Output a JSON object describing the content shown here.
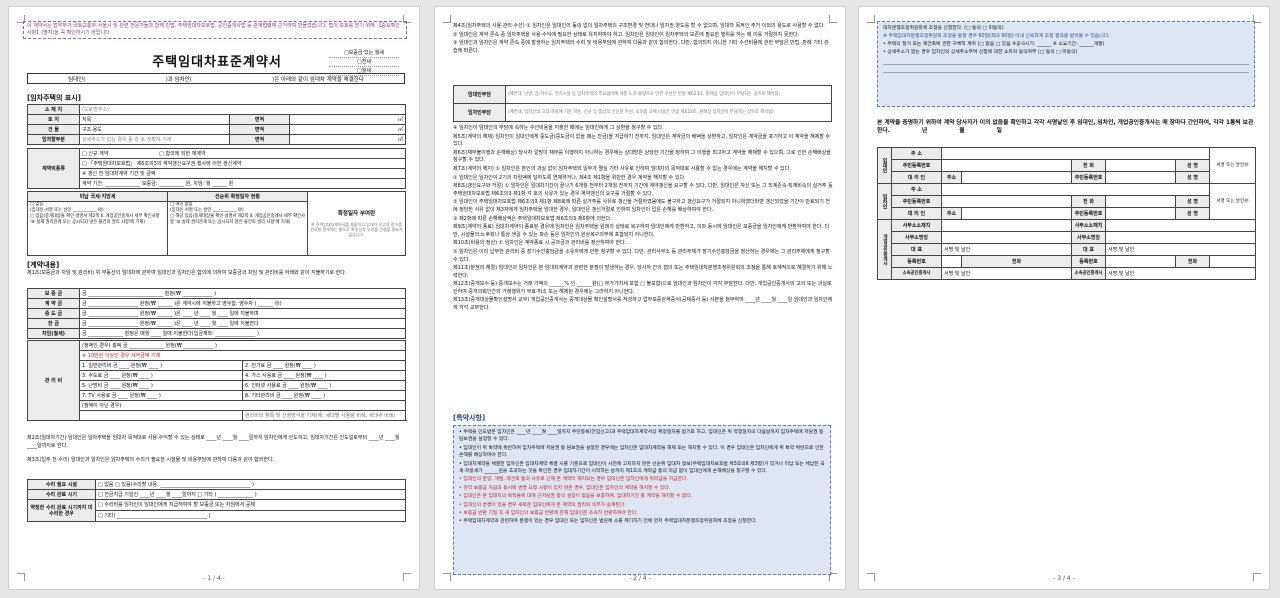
{
  "page1": {
    "notice": "이 계약서는 법무부가 국토교통부·서울시 및 관련 전문가들과 함께 민법, 주택임대차보호법, 공인중개사법 등 관계법령에 근거하여 만들었습니다. 법의 보호를 받기 위해 【중요확인사항】(별지)을 꼭 확인하시기 바랍니다.",
    "title": "주택임대차표준계약서",
    "stamp_lines": [
      "□보증금 있는 월세",
      "□전세",
      "□월세"
    ],
    "party_line": [
      "임대인(",
      ")과 임차인(",
      ")은 아래와 같이 임대차 계약을 체결한다"
    ],
    "section1": "[임차주택의 표시]",
    "property_rows": [
      [
        "소 재 지",
        "(도로명주소)",
        "",
        ""
      ],
      [
        "토    지",
        "지목",
        "면적",
        "㎡"
      ],
      [
        "건    물",
        "구조·용도",
        "면적",
        "㎡"
      ],
      [
        "임차할부분",
        "상세주소가 있는 경우 동·층·호 정확히 기재",
        "면적",
        "㎡"
      ]
    ],
    "contract_type_label": "계약의종류",
    "contract_type_items": [
      "□ 신규 계약",
      "□ 합의에 의한 재계약",
      "□ 「주택임대차보호법」 제6조의3의 계약갱신요구권 행사에 의한 갱신계약",
      "※ 갱신 전 임대차계약 기간 및 금액",
      "계약 기간:",
      "보증금:",
      "원, 차임: 월",
      "원"
    ],
    "tax_headers": [
      "미납 국세·지방세",
      "선순위 확정일자 현황",
      "확정일자 부여란"
    ],
    "tax_items": [
      "□ 없음",
      "(임대인 서명 또는 날인 ___________ ㊞)",
      "□ 있음(중개대상물 확인·설명서 제2쪽 Ⅱ. 개업공인중개사 세부 확인사항 '⑨ 실제 권리관계 또는 공시되지 않은 물건의 권리 사항'에 기재)",
      "□ 해당 없음",
      "(임대인 서명 또는 날인 ___________ ㊞)",
      "□ 해당 있음(중개대상물 확인·설명서 제2쪽 Ⅱ. 개업공인중개사 세부 확인사항 '⑨ 실제 권리관계 또는 공시되지 않은 물건의 권리 사항'에 기재)",
      "※ 주택임대차계약서를 제출하고 임대차 신고의 접수를 완료한 경우에는 별도로 확정일자 부여를 신청할 필요가 없습니다."
    ],
    "section2": "[계약내용]",
    "clause1": "제1조(보증금과 차임 및 관리비) 위 부동산의 임대차에 관하여 임대인과 임차인은 합의에 의하여 보증금과 차임 및 관리비를 아래와 같이 지불하기로 한다.",
    "money_rows": [
      [
        "보 증 금",
        "금",
        "원정(₩",
        ")"
      ],
      [
        "계 약 금",
        "금",
        "원정(₩",
        ")은 계약시에 지불하고 영수함. 영수자 (",
        "㊞)"
      ],
      [
        "중 도 금",
        "금",
        "원정(₩",
        ")은",
        "년",
        "월",
        "일에 지불하며"
      ],
      [
        "잔    금",
        "금",
        "원정(₩",
        ")은",
        "년",
        "월",
        "일에 지불한다"
      ],
      [
        "차임(월세)",
        "금",
        "원정은 매월",
        "일에 지불한다(입금계좌:",
        ")"
      ]
    ],
    "mgmt_label": "관 리 비",
    "mgmt_fixed": "(정액인 경우) 총액 금",
    "mgmt_fixed_2": "원정(₩",
    "mgmt_note": "※ 10만원 이상인 경우 세부금액 기재",
    "mgmt_items": [
      [
        "1. 일반관리비",
        "금",
        "원정(₩",
        ")"
      ],
      [
        "2. 전기료",
        "금",
        "원정(₩",
        ")"
      ],
      [
        "3. 수도료",
        "금",
        "원정(₩",
        ")"
      ],
      [
        "4. 가스 사용료",
        "금",
        "원정(₩",
        ")"
      ],
      [
        "5. 난방비",
        "금",
        "원정(₩",
        ")"
      ],
      [
        "6. 인터넷 사용료",
        "금",
        "원정(₩",
        ")"
      ],
      [
        "7. TV 사용료",
        "금",
        "원정(₩",
        ")"
      ],
      [
        "8. 기타관리비",
        "금",
        "원정(₩",
        ")"
      ]
    ],
    "mgmt_variable": "(정액이 아닌 경우)",
    "mgmt_variable_note": "관리비의 항목 및 산정방식을 기재(예: 세대별 사용량 비례, 세대수 비례)",
    "clause2": "제2조(임대차기간) 임대인은 임차주택을 임대차 목적대로 사용·수익할 수 있는 상태로 ____년 ____월 ____일까지 임차인에게 인도하고, 임대차기간은 인도일로부터 ____년 ____월 ____일까지로 한다.",
    "clause3": "제3조(입주 전 수리) 임대인과 임차인은 임차주택의 수리가 필요한 시설물 및 비용부담에 관하여 다음과 같이 합의한다.",
    "repair_rows": [
      [
        "수리 필요 시설",
        "□ 없음 □ 있음(수리할 내용:",
        ")"
      ],
      [
        "수리 완료 시기",
        "□ 잔금지급 기일인 ____년 ____월 ____일까지 □ 기타 (",
        ")"
      ],
      [
        "약정한 수리 완료 시기까지 미 수리한 경우",
        "□ 수리비를 임차인이 임대인에게 지급하여야 할 보증금 또는 차임에서 공제",
        "□ 기타(",
        ")"
      ]
    ],
    "page_num": "- 1 / 4 -"
  },
  "page2": {
    "paragraphs": [
      "제4조(임차주택의 사용·관리·수선) ① 임차인은 임대인의 동의 없이 임차주택의 구조변경 및 전대나 임차권 양도를 할 수 없으며, 임대차 목적인 주거 이외의 용도로 사용할 수 없다.",
      "② 임대인은 계약 존속 중 임차주택을 사용·수익에 필요한 상태로 유지하여야 하고, 임차인은 임대인이 임차주택의 보존에 필요한 행위를 하는 때 이를 거절하지 못한다.",
      "③ 임대인과 임차인은 계약 존속 중에 발생하는 임차주택의 수리 및 비용부담에 관하여 다음과 같이 합의한다. 다만, 합의되지 아니한 기타 수선비용에 관한 부담은 민법, 판례 기타 관습에 따른다."
    ],
    "cost_rows": [
      [
        "임대인부담",
        "(예컨대, 난방, 상·하수도, 전기시설 등 임차주택의 주요설비에 대한 노후·불량으로 인한 수선은 민법 제623조, 판례상 임대인이 부담하는 것으로 해석됨)"
      ],
      [
        "임차인부담",
        "(예컨대, 임차인의 고의·과실에 기한 파손, 전구 등 통상의 간단한 수선, 소모품 교체 비용은 민법 제623조, 판례상 임차인이 부담하는 것으로 해석됨)"
      ]
    ],
    "paragraphs_b": [
      "④ 임차인이 임대인의 부담에 속하는 수선비용을 지출한 때에는 임대인에게 그 상환을 청구할 수 있다.",
      "제5조(계약의 해제) 임차인이 임대인에게 중도금(중도금이 없을 때는 잔금)을 지급하기 전까지, 임대인은 계약금의 배액을 상환하고, 임차인은 계약금을 포기하고 이 계약을 해제할 수 있다.",
      "제6조(채무불이행과 손해배상) 당사자 일방이 채무를 이행하지 아니하는 경우에는 상대방은 상당한 기간을 정하여 그 이행을 최고하고 계약을 해제할 수 있으며, 그로 인한 손해배상을 청구할 수 있다.",
      "제7조(계약의 해지) ① 임차인은 본인의 과실 없이 임차주택의 일부가 멸실 기타 사유로 인하여 임대차의 목적대로 사용할 수 없는 경우에는 계약을 해지할 수 있다.",
      "② 임대인은 임차인이 2기의 차임액에 달하도록 연체하거나, 제4조 제1항을 위반한 경우 계약을 해지할 수 있다.",
      "제8조(갱신요구와 거절) ① 임차인은 임대차기간이 끝나기 6개월 전부터 2개월 전까지 기간에 계약갱신을 요구할 수 있다. 다만, 임대인은 자신 또는 그 직계존속·직계비속의 실거주 등 주택임대차보호법 제6조의3 제1항 각 호의 사유가 있는 경우 계약갱신의 요구를 거절할 수 있다.",
      "② 임대인이 주택임대차보호법 제6조의3 제1항 제8호에 따른 실거주를 사유로 갱신을 거절하였음에도 불구하고 갱신요구가 거절되지 아니하였더라면 갱신되었을 기간이 만료되기 전에 정당한 사유 없이 제3자에게 임차주택을 임대한 경우, 임대인은 갱신거절로 인하여 임차인이 입은 손해를 배상하여야 한다.",
      "③ 제2항에 따른 손해배상액은 주택임대차보호법 제6조의3 제6항에 의한다.",
      "제9조(계약의 종료) 임대차계약이 종료된 경우에 임차인은 임차주택을 원래의 상태로 복구하여 임대인에게 반환하고, 이와 동시에 임대인은 보증금을 임차인에게 반환하여야 한다. 다만, 시설물의 노후화나 통상 생길 수 있는 파손 등은 임차인의 원상복구의무에 포함되지 아니한다.",
      "제10조(비용의 정산) ① 임차인은 계약종료 시 공과금과 관리비를 정산하여야 한다.",
      "② 임차인은 이미 납부한 관리비 중 장기수선충당금을 소유자에게 반환 청구할 수 있다. 다만, 관리사무소 등 관리주체가 장기수선충당금을 정산하는 경우에는 그 관리주체에게 청구할 수 있다.",
      "제11조(분쟁의 해결) 임대인과 임차인은 본 임대차계약과 관련한 분쟁이 발생하는 경우, 당사자 간의 협의 또는 주택임대차분쟁조정위원회의 조정을 통해 호혜적으로 해결하기 위해 노력한다.",
      "제12조(중개보수 등) 중개보수는 거래 가액의 ______% 인 ______원(□ 부가가치세 포함 □ 불포함)으로 임대인과 임차인이 각각 부담한다. 다만, 개업공인중개사의 고의 또는 과실로 인하여 중개의뢰인간의 거래행위가 무효·취소 또는 해제된 경우에는 그러하지 아니한다.",
      "제13조(중개대상물확인설명서 교부) 개업공인중개사는 중개대상물 확인설명서를 작성하고 업무보증관계증서(공제증서 등) 사본을 첨부하여 ____년 ____월 ____일 임대인과 임차인에게 각각 교부한다."
    ],
    "special_title": "[특약사항]",
    "special_items": [
      "• 주택을 인도받은 임차인은 ____년 ____월 ____일까지 주민등록(전입신고)과 주택임대차계약서상 확정일자를 받기로 하고, 임대인은 위 약정일자의 다음날까지 임차주택에 저당권 등 담보권을 설정할 수 있다.",
      "• 임대인이 위 특약에 위반하여 임차주택에 저당권 등 담보권을 설정한 경우에는 임차인은 임대차계약을 해제 또는 해지할 수 있다. 이 경우 임대인은 임차인에게 위 특약 위반으로 인한 손해를 배상하여야 한다.",
      "• 임대차계약을 체결한 임차인은 임대차계약 체결 시를 기준으로 임대인이 사전에 고지하지 않은 선순위 임대차 정보(주택임대차보호법 제3조의6 제3항)가 있거나 미납 또는 체납한 국세·지방세가 ______원을 초과하는 것을 확인한 경우 임대차기간이 시작하는 날까지 제1조의 계약금 등의 지급 없이 임대인에게 손해배상을 청구할 수 있다.",
      "• 임대인의 분양, 개발, 재건축 등의 사유로 인해 본 계약이 해지되는 경우 임대인은 임차인에게 위약금을 지급한다.",
      "• 관리 보증금 지급과 동시에 변경 요청 사항이 있지 않은 경우, 임대인은 임차인의 계약을 해지할 수 있다.",
      "• 임대인은 본 임대차의 목적물에 대해 근저당권 등의 설정이 없음을 보증하며, 임대차기간 중 계약을 해지할 수 없다.",
      "• 임대인의 변경이 있을 경우 새로운 임대인에게 본 계약의 권리와 의무가 승계된다.",
      "• 보증금 반환 기일 후 새 임차인의 보증금 반환에 관해 임대인은 조속히 반환하여야 한다.",
      "• 주택임대차계약과 관련하여 분쟁이 있는 경우 임대인 또는 임차인은 법원에 소를 제기하기 전에 먼저 주택임대차분쟁조정위원회에 조정을 신청한다."
    ],
    "page_num": "- 2 / 4 -"
  },
  "page3": {
    "box_lines": [
      "대차분쟁조정위원회에 조정을 신청한다. (□ 동의 □ 미동의)",
      "※ 주택임대차분쟁조정위원회 조정을 통할 경우 60일(최대 90일) 이내 신속하게 조정 결과를 받아볼 수 있습니다.",
      "• 주택의 철거 또는 재건축에 관한 구체적 계획 (□ 없음 □ 있음 ※공사시기: ______ ※ 소요기간: ______개월)",
      "• 상세주소가 없는 경우 임차인의 상세주소부여 신청에 대한 소유자 동의여부 (□ 동의 □ 미동의)"
    ],
    "closing_text": "본 계약을 증명하기 위하여 계약 당사자가 이의 없음을 확인하고 각각 서명날인 후 임대인, 임차인, 개업공인중개사는 매 장마다 간인하여, 각각 1통씩 보관한다.",
    "date_labels": [
      "년",
      "월",
      "일"
    ],
    "landlord_label": "임대인",
    "tenant_label": "임차인",
    "agent_label": "개업공인중개사",
    "sig_fields": [
      "주    소",
      "주민등록번호",
      "전    화",
      "성    명",
      "대 리 인",
      "주소",
      "서명 또는 날인㊞"
    ],
    "agent_fields": [
      "사무소소재지",
      "사무소소재지",
      "사무소명칭",
      "사무소명칭",
      "대    표",
      "서명 및 날인",
      "대    표",
      "서명 및 날인",
      "등록번호",
      "전화",
      "등록번호",
      "전화",
      "소속공인중개사",
      "서명 및 날인",
      "소속공인중개사",
      "서명 및 날인"
    ],
    "page_num": "- 3 / 4 -"
  },
  "colors": {
    "special_bg": "#dde6f2",
    "notice_text": "#8a3a8a",
    "header_bg": "#ececec"
  }
}
